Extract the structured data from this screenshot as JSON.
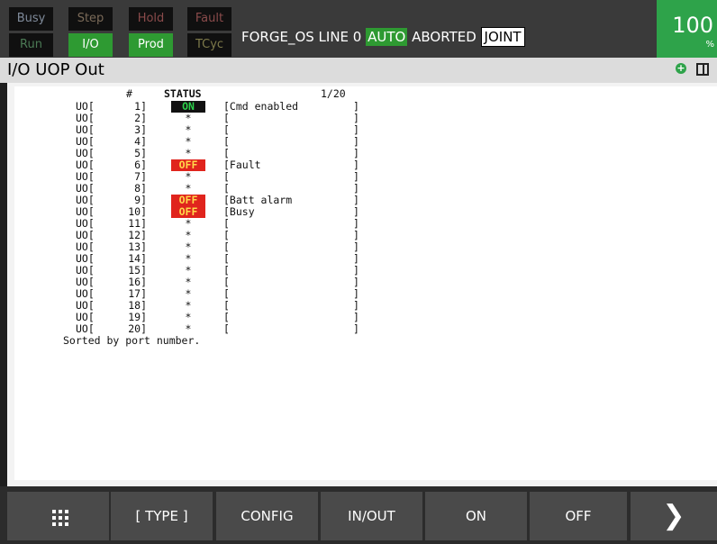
{
  "indicators": {
    "busy": "Busy",
    "step": "Step",
    "hold": "Hold",
    "fault": "Fault",
    "run": "Run",
    "io": "I/O",
    "prod": "Prod",
    "tcyc": "TCyc"
  },
  "status": {
    "program": "FORGE_OS LINE 0",
    "mode": "AUTO",
    "state": "ABORTED",
    "coord": "JOINT"
  },
  "override": {
    "value": "100",
    "unit": "%"
  },
  "title": "I/O UOP Out",
  "title_icons": [
    "zoom-in-icon",
    "split-screen-icon"
  ],
  "table": {
    "col_hash": "#",
    "col_status": "STATUS",
    "page": "1/20",
    "rows": [
      {
        "prefix": "UO[",
        "num": "1]",
        "status": "ON",
        "status_type": "on",
        "comment": "[Cmd enabled",
        "end": "]"
      },
      {
        "prefix": "UO[",
        "num": "2]",
        "status": "*",
        "status_type": "none",
        "comment": "[",
        "end": "]"
      },
      {
        "prefix": "UO[",
        "num": "3]",
        "status": "*",
        "status_type": "none",
        "comment": "[",
        "end": "]"
      },
      {
        "prefix": "UO[",
        "num": "4]",
        "status": "*",
        "status_type": "none",
        "comment": "[",
        "end": "]"
      },
      {
        "prefix": "UO[",
        "num": "5]",
        "status": "*",
        "status_type": "none",
        "comment": "[",
        "end": "]"
      },
      {
        "prefix": "UO[",
        "num": "6]",
        "status": "OFF",
        "status_type": "off",
        "comment": "[Fault",
        "end": "]"
      },
      {
        "prefix": "UO[",
        "num": "7]",
        "status": "*",
        "status_type": "none",
        "comment": "[",
        "end": "]"
      },
      {
        "prefix": "UO[",
        "num": "8]",
        "status": "*",
        "status_type": "none",
        "comment": "[",
        "end": "]"
      },
      {
        "prefix": "UO[",
        "num": "9]",
        "status": "OFF",
        "status_type": "off",
        "comment": "[Batt alarm",
        "end": "]"
      },
      {
        "prefix": "UO[",
        "num": "10]",
        "status": "OFF",
        "status_type": "off",
        "comment": "[Busy",
        "end": "]"
      },
      {
        "prefix": "UO[",
        "num": "11]",
        "status": "*",
        "status_type": "none",
        "comment": "[",
        "end": "]"
      },
      {
        "prefix": "UO[",
        "num": "12]",
        "status": "*",
        "status_type": "none",
        "comment": "[",
        "end": "]"
      },
      {
        "prefix": "UO[",
        "num": "13]",
        "status": "*",
        "status_type": "none",
        "comment": "[",
        "end": "]"
      },
      {
        "prefix": "UO[",
        "num": "14]",
        "status": "*",
        "status_type": "none",
        "comment": "[",
        "end": "]"
      },
      {
        "prefix": "UO[",
        "num": "15]",
        "status": "*",
        "status_type": "none",
        "comment": "[",
        "end": "]"
      },
      {
        "prefix": "UO[",
        "num": "16]",
        "status": "*",
        "status_type": "none",
        "comment": "[",
        "end": "]"
      },
      {
        "prefix": "UO[",
        "num": "17]",
        "status": "*",
        "status_type": "none",
        "comment": "[",
        "end": "]"
      },
      {
        "prefix": "UO[",
        "num": "18]",
        "status": "*",
        "status_type": "none",
        "comment": "[",
        "end": "]"
      },
      {
        "prefix": "UO[",
        "num": "19]",
        "status": "*",
        "status_type": "none",
        "comment": "[",
        "end": "]"
      },
      {
        "prefix": "UO[",
        "num": "20]",
        "status": "*",
        "status_type": "none",
        "comment": "[",
        "end": "]"
      }
    ],
    "footer": "Sorted by port number."
  },
  "function_keys": {
    "menu_icon": "grid-menu-icon",
    "type": "[ TYPE ]",
    "config": "CONFIG",
    "inout": "IN/OUT",
    "on": "ON",
    "off": "OFF",
    "next_icon": "chevron-right-icon"
  },
  "colors": {
    "active_green": "#2e9a32",
    "override_green": "#2ea34a",
    "off_red": "#e0241d",
    "on_text_green": "#2bd24a"
  }
}
